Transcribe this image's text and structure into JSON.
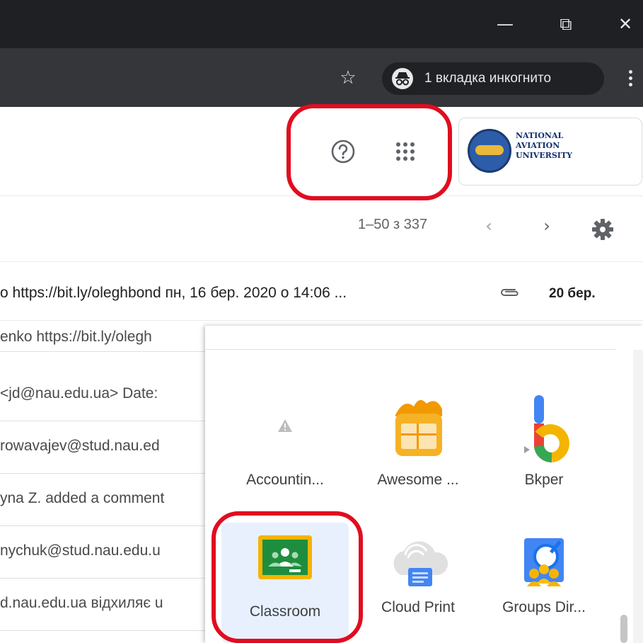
{
  "window": {
    "controls": {
      "minimize": "—",
      "restore": "⧉",
      "close": "✕"
    }
  },
  "toolbar": {
    "bookmark_icon": "star-icon",
    "incognito_label": "1 вкладка инкогнито",
    "menu_icon": "kebab-menu-icon"
  },
  "header": {
    "help_icon": "help-icon",
    "apps_icon": "apps-grid-icon",
    "org_logo_text": [
      "NATIONAL",
      "AVIATION",
      "UNIVERSITY"
    ]
  },
  "pager": {
    "count": "1–50 з 337",
    "prev": "‹",
    "next": "›",
    "settings_icon": "gear-icon"
  },
  "message": {
    "snippet": "o https://bit.ly/oleghbond пн, 16 бер. 2020 о 14:06 ...",
    "date": "20 бер."
  },
  "background_rows": [
    "enko https://bit.ly/olegh",
    "<jd@nau.edu.ua> Date:",
    "rowavajev@stud.nau.ed",
    "yna Z. added a comment",
    "nychuk@stud.nau.edu.u",
    "d.nau.edu.ua відхиляє u"
  ],
  "apps": [
    {
      "label": "Accountin...",
      "icon": "warning-icon"
    },
    {
      "label": "Awesome ...",
      "icon": "awesome-table-icon"
    },
    {
      "label": "Bkper",
      "icon": "bkper-icon"
    },
    {
      "label": "Classroom",
      "icon": "classroom-icon"
    },
    {
      "label": "Cloud Print",
      "icon": "cloud-print-icon"
    },
    {
      "label": "Groups Dir...",
      "icon": "groups-directory-icon"
    }
  ],
  "colors": {
    "highlight": "#e00d1f",
    "titlebar": "#1f2023",
    "toolbar": "#35363a",
    "classroom_green": "#1e8e3e",
    "classroom_yellow": "#f4b400"
  }
}
